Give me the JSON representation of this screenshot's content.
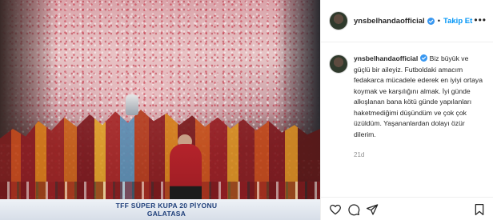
{
  "post": {
    "username": "ynsbelhandaofficial",
    "follow_label": "Takip Et",
    "separator": "•",
    "more_label": "•••",
    "caption_text": "Biz büyük ve güçlü bir aileyiz. Futboldaki amacım fedakarca mücadele ederek en iyiyi ortaya koymak ve karşılığını almak. İyi günde alkışlanan bana kötü günde yapılanları haketmediğimi düşündüm ve çok çok üzüldüm. Yaşananlardan dolayı özür dilerim.",
    "timestamp": "21d"
  },
  "photo": {
    "banner_line1": "TFF SÜPER KUPA 20   PİYONU",
    "banner_line2": "GALATASA"
  },
  "icons": {
    "verified": "verified-badge-icon",
    "like": "heart-icon",
    "comment": "comment-icon",
    "share": "paper-plane-icon",
    "save": "bookmark-icon",
    "more": "more-options-icon"
  },
  "colors": {
    "link_blue": "#0095f6",
    "verified_blue": "#3897f0",
    "muted": "#8e8e8e",
    "text": "#262626"
  }
}
